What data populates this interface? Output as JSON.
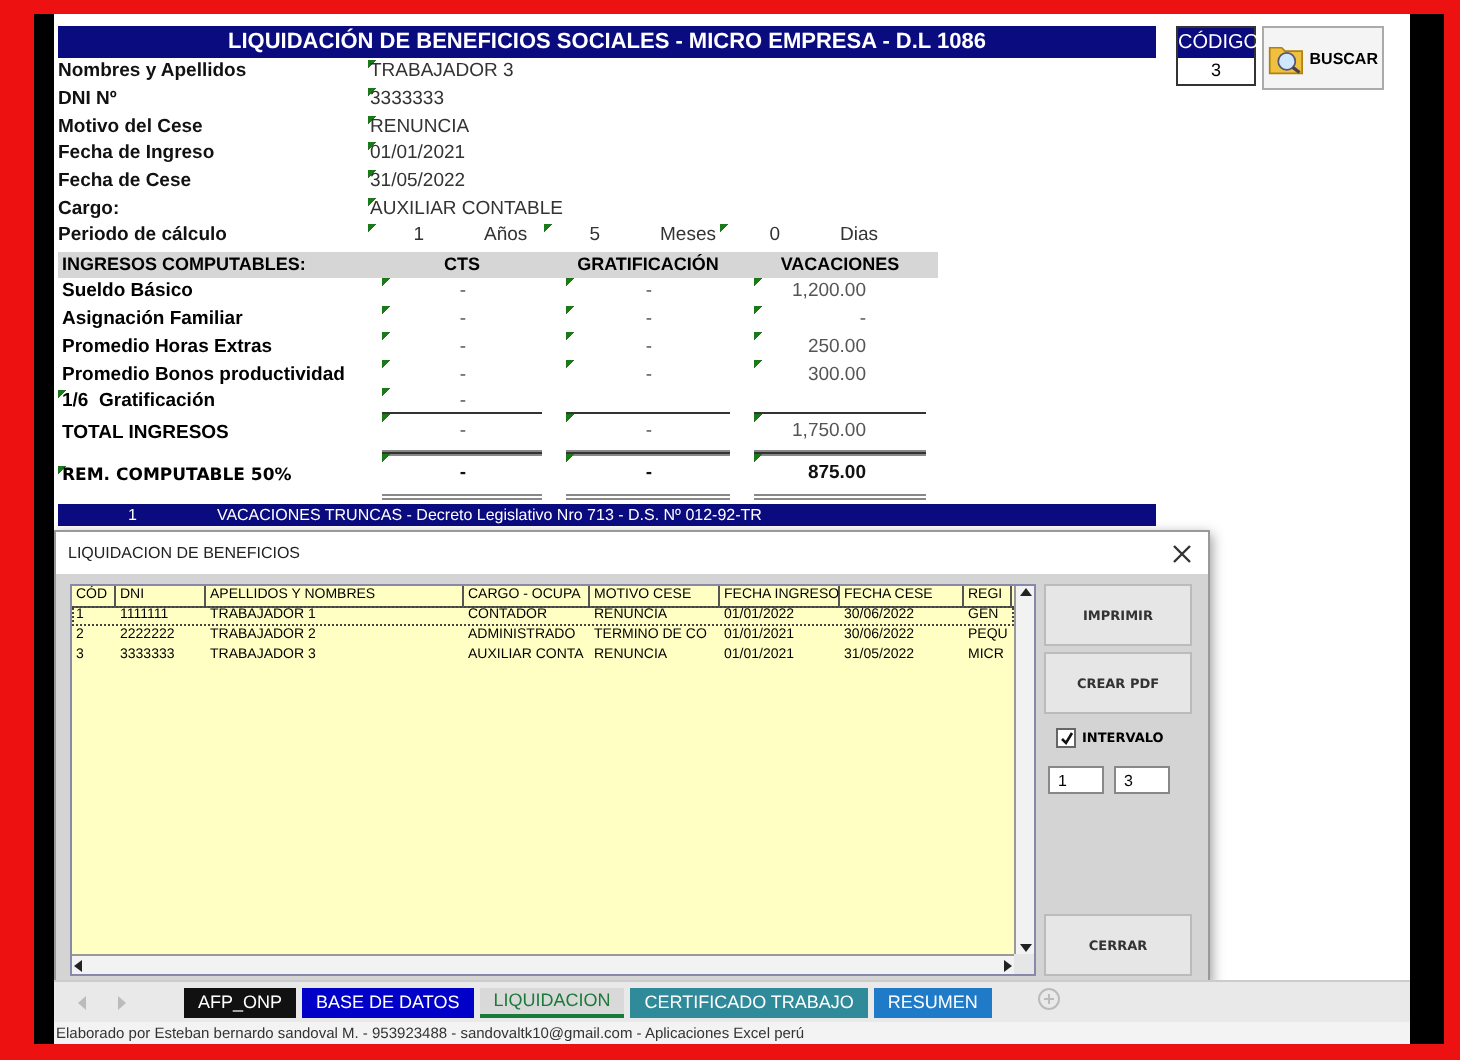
{
  "title": "LIQUIDACIÓN DE BENEFICIOS SOCIALES - MICRO EMPRESA - D.L 1086",
  "codigo": {
    "label": "CÓDIGO",
    "value": "3"
  },
  "search_button": {
    "label": "BUSCAR"
  },
  "fields": [
    {
      "label": "Nombres y Apellidos",
      "value": "TRABAJADOR 3"
    },
    {
      "label": "DNI Nº",
      "value": "3333333"
    },
    {
      "label": "Motivo del Cese",
      "value": "RENUNCIA"
    },
    {
      "label": "Fecha de Ingreso",
      "value": "01/01/2021"
    },
    {
      "label": "Fecha de Cese",
      "value": "31/05/2022"
    },
    {
      "label": "Cargo:",
      "value": "AUXILIAR CONTABLE"
    }
  ],
  "periodo": {
    "label": "Periodo de cálculo",
    "parts": [
      {
        "value": "1",
        "unit": "Años"
      },
      {
        "value": "5",
        "unit": "Meses"
      },
      {
        "value": "0",
        "unit": "Dias"
      }
    ]
  },
  "ingresos": {
    "heading": "INGRESOS COMPUTABLES:",
    "columns": [
      "CTS",
      "GRATIFICACIÓN",
      "VACACIONES"
    ],
    "rows": [
      {
        "kind": "item",
        "label": "Sueldo Básico",
        "cells": [
          "-",
          "-",
          "1,200.00"
        ]
      },
      {
        "kind": "item",
        "label": "Asignación Familiar",
        "cells": [
          "-",
          "-",
          "-"
        ]
      },
      {
        "kind": "item",
        "label": "Promedio Horas Extras",
        "cells": [
          "-",
          "-",
          "250.00"
        ]
      },
      {
        "kind": "item",
        "label": "Promedio Bonos productividad",
        "cells": [
          "-",
          "-",
          "300.00"
        ]
      },
      {
        "kind": "item",
        "label": "1/6  Gratificación",
        "cells": [
          "-"
        ]
      },
      {
        "kind": "total",
        "label": "TOTAL INGRESOS",
        "cells": [
          "-",
          "-",
          "1,750.00"
        ]
      },
      {
        "kind": "result",
        "label": "REM. COMPUTABLE 50%",
        "cells": [
          "-",
          "-",
          "875.00"
        ]
      }
    ]
  },
  "section_bar": {
    "number": "1",
    "text": "VACACIONES TRUNCAS - Decreto Legislativo Nro 713 - D.S. Nº 012-92-TR"
  },
  "dialog": {
    "title": "LIQUIDACION DE BENEFICIOS",
    "list": {
      "columns": [
        "CÓD",
        "DNI",
        "APELLIDOS Y NOMBRES",
        "CARGO - OCUPA",
        "MOTIVO CESE",
        "FECHA INGRESO",
        "FECHA CESE",
        "REGI"
      ],
      "rows": [
        {
          "selected": true,
          "cells": [
            "1",
            "1111111",
            "TRABAJADOR 1",
            "CONTADOR",
            "RENUNCIA",
            "01/01/2022",
            "30/06/2022",
            "GEN"
          ]
        },
        {
          "selected": false,
          "cells": [
            "2",
            "2222222",
            "TRABAJADOR 2",
            "ADMINISTRADO",
            "TERMINO DE CO",
            "01/01/2021",
            "30/06/2022",
            "PEQU"
          ]
        },
        {
          "selected": false,
          "cells": [
            "3",
            "3333333",
            "TRABAJADOR 3",
            "AUXILIAR CONTA",
            "RENUNCIA",
            "01/01/2021",
            "31/05/2022",
            "MICR"
          ]
        }
      ]
    },
    "buttons": [
      "IMPRIMIR",
      "CREAR PDF"
    ],
    "interval": {
      "label": "INTERVALO",
      "checked": true,
      "from": "1",
      "to": "3"
    },
    "close_button": "CERRAR"
  },
  "sheet_tabs": [
    {
      "label": "AFP_ONP",
      "color": "#111111",
      "selected": false
    },
    {
      "label": "BASE DE DATOS",
      "color": "#0000c8",
      "selected": false
    },
    {
      "label": "LIQUIDACION",
      "color": "#d9d9d9",
      "selected": true
    },
    {
      "label": "CERTIFICADO TRABAJO",
      "color": "#2f8a9a",
      "selected": false
    },
    {
      "label": "RESUMEN",
      "color": "#1f7bc8",
      "selected": false
    }
  ],
  "status_bar": "Elaborado por Esteban bernardo sandoval M. - 953923488 - sandovaltk10@gmail.com - Aplicaciones Excel perú"
}
